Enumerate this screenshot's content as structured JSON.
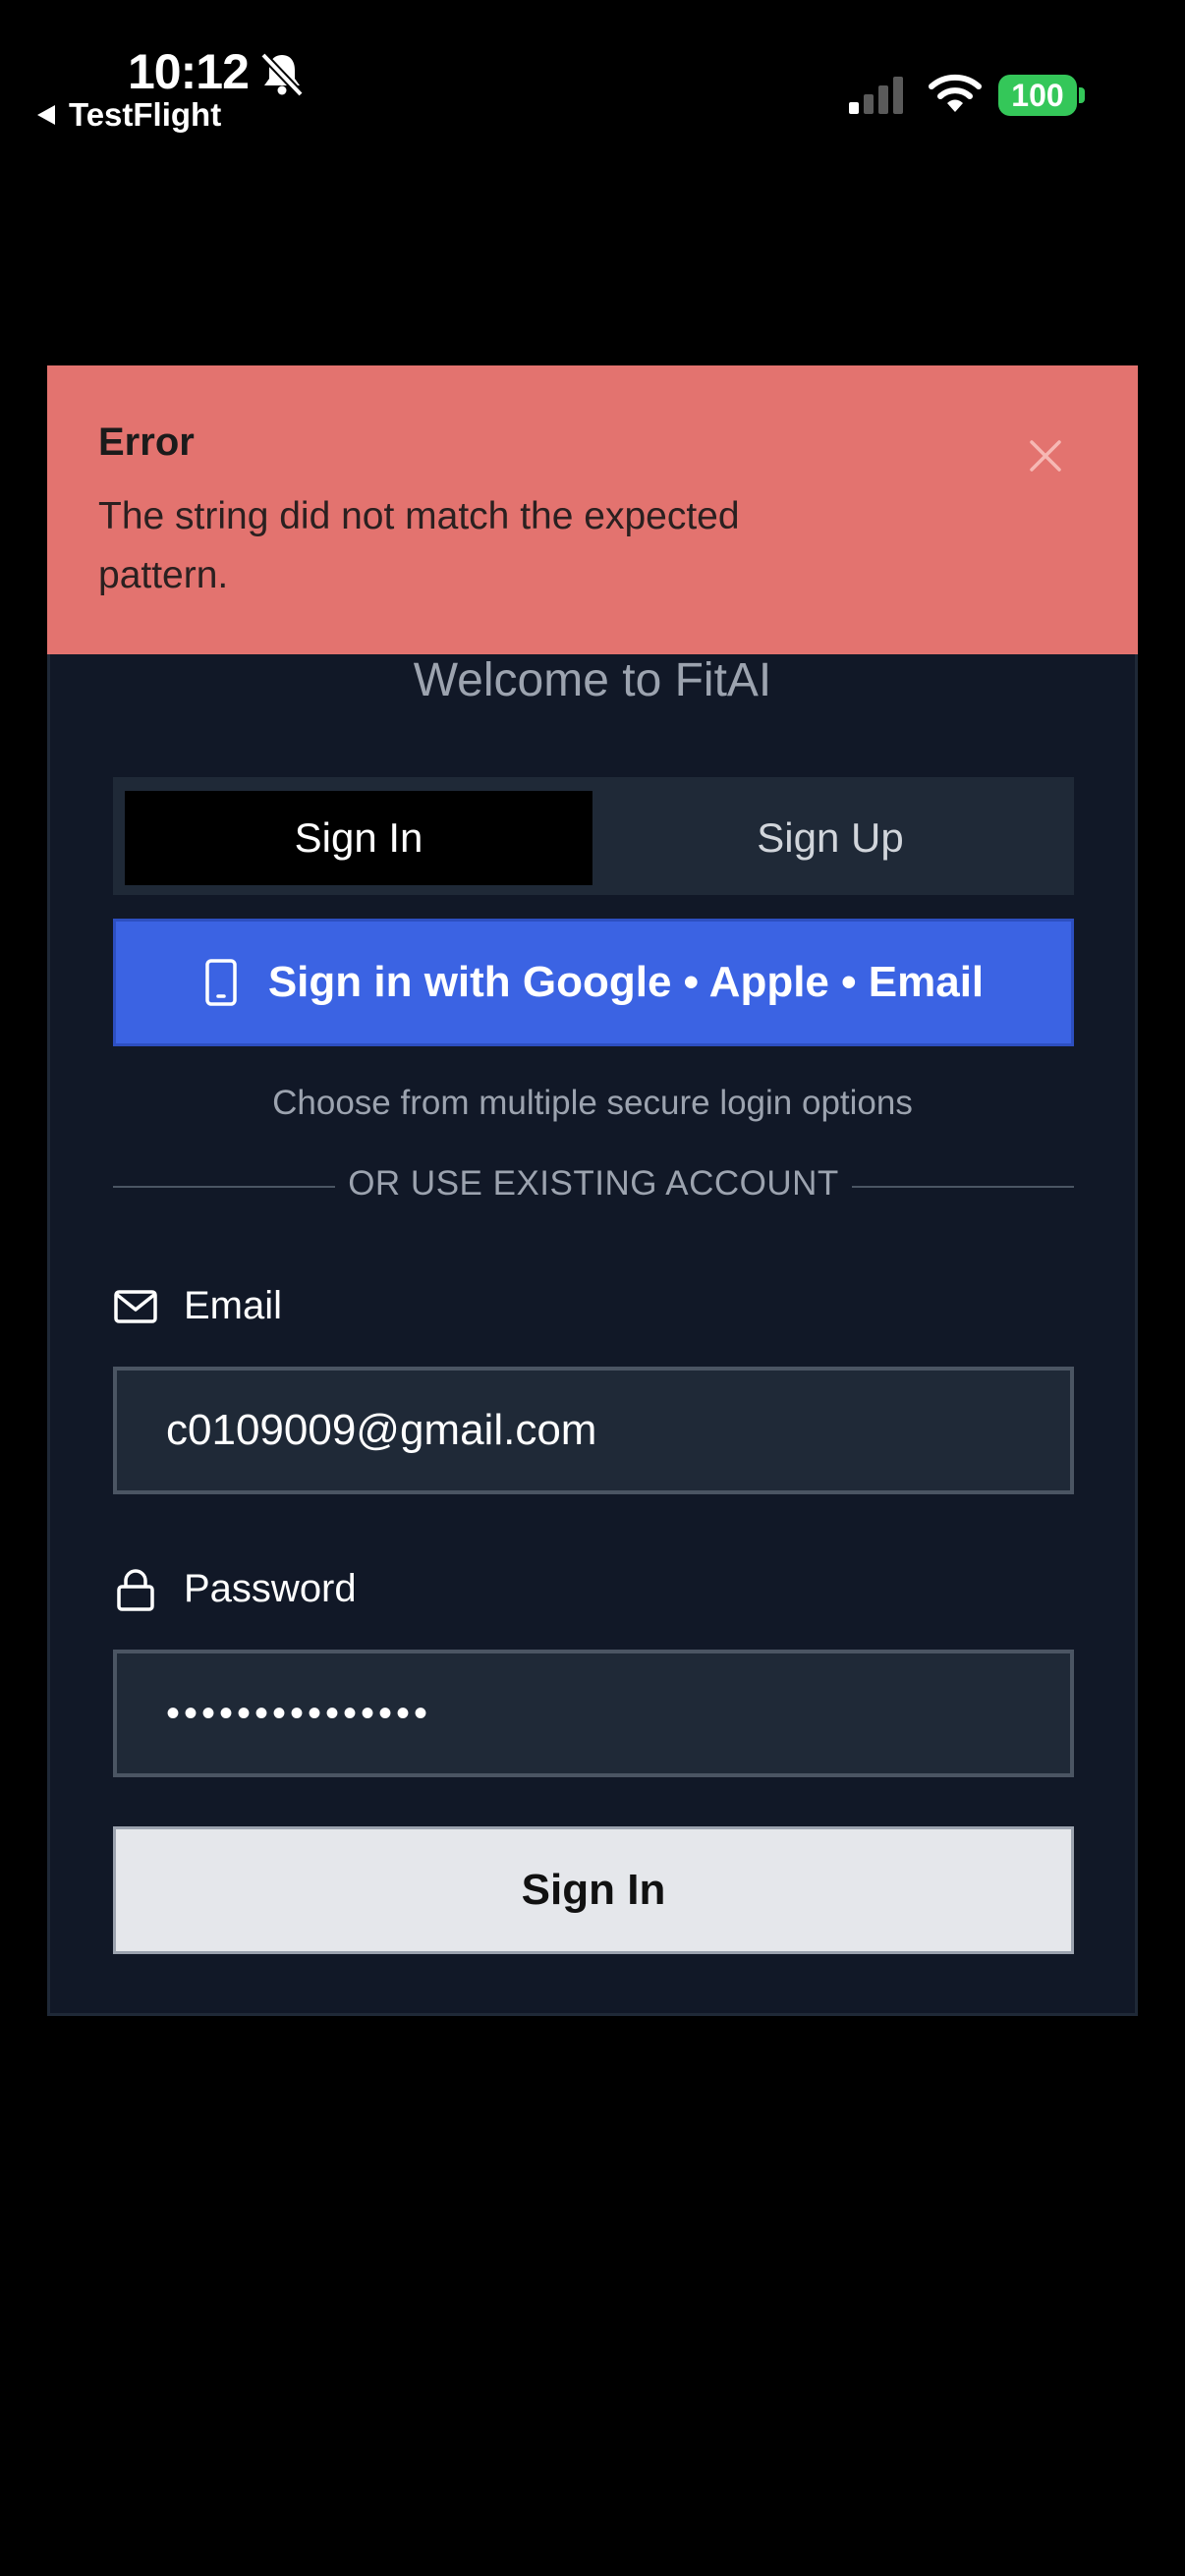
{
  "status_bar": {
    "time": "10:12",
    "back_app": "TestFlight",
    "battery": "100",
    "icons": [
      "bell-slash-icon",
      "cellular-signal-icon",
      "wifi-icon",
      "battery-icon"
    ],
    "battery_color": "#34c759"
  },
  "toast": {
    "title": "Error",
    "message": "The string did not match the expected pattern.",
    "close_icon": "close-icon",
    "background": "#e3736f"
  },
  "auth": {
    "welcome": "Welcome to FitAI",
    "tabs": [
      {
        "label": "Sign In",
        "active": true
      },
      {
        "label": "Sign Up",
        "active": false
      }
    ],
    "provider_button": "Sign in with Google • Apple • Email",
    "provider_icon": "smartphone-icon",
    "provider_hint": "Choose from multiple secure login options",
    "divider": "OR USE EXISTING ACCOUNT",
    "email": {
      "label": "Email",
      "icon": "mail-icon",
      "value": "c0109009@gmail.com"
    },
    "password": {
      "label": "Password",
      "icon": "lock-icon",
      "value": "•••••••••••••••"
    },
    "submit": "Sign In",
    "accent_color": "#3b63e3"
  }
}
